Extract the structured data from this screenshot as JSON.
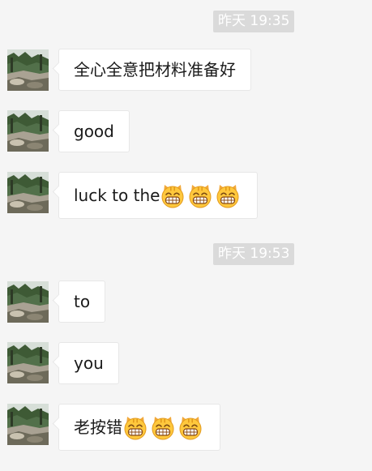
{
  "timestamps": [
    "昨天 19:35",
    "昨天 19:53"
  ],
  "messages": [
    {
      "text": "全心全意把材料准备好",
      "emoji_count": 0
    },
    {
      "text": "good",
      "emoji_count": 0
    },
    {
      "text": "luck to the",
      "emoji_count": 3
    },
    {
      "text": "to",
      "emoji_count": 0
    },
    {
      "text": "you",
      "emoji_count": 0
    },
    {
      "text": "老按错",
      "emoji_count": 3
    }
  ],
  "icons": {
    "avatar": "landscape-photo-avatar",
    "emoji": "grinning-cat-emoji"
  },
  "colors": {
    "background": "#f5f5f5",
    "bubble": "#ffffff",
    "timestamp_bg": "#dadada"
  }
}
